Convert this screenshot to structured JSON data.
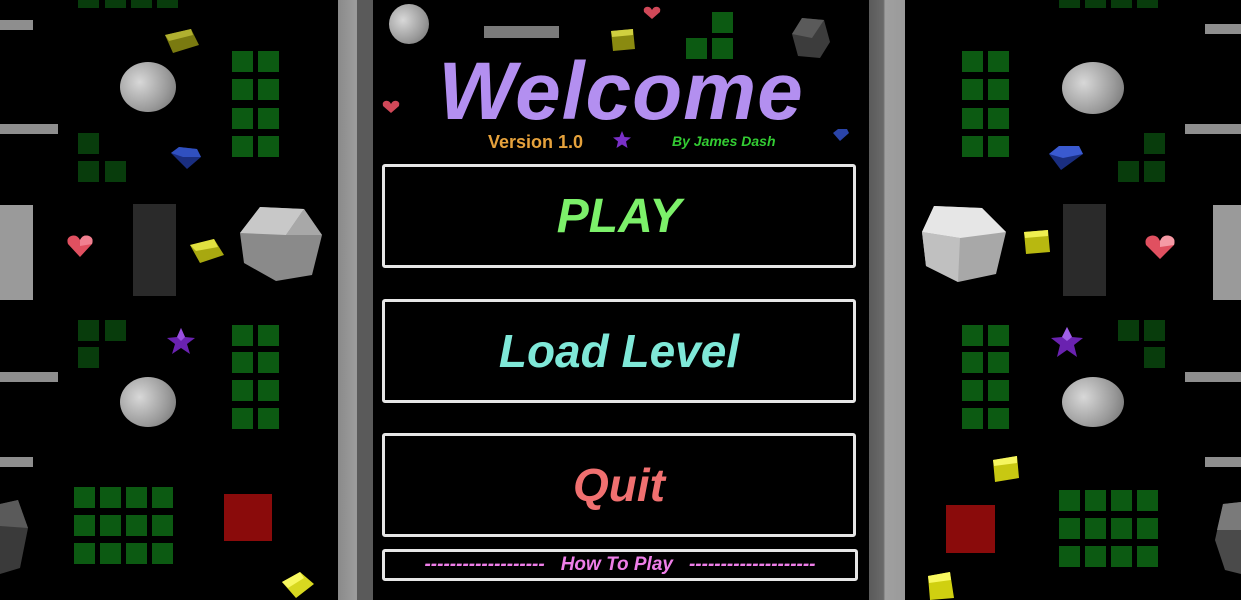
{
  "menu": {
    "title": "Welcome",
    "version": "Version 1.0",
    "author": "By James Dash",
    "play_label": "PLAY",
    "load_label": "Load Level",
    "quit_label": "Quit",
    "howto_label": "How To Play",
    "howto_dashes_left": "-------------------",
    "howto_dashes_right": "--------------------"
  },
  "colors": {
    "title": "#b38ff0",
    "version": "#e6a23c",
    "author": "#33cc33",
    "play": "#7cf06a",
    "load": "#7fe8d8",
    "quit": "#f07070",
    "howto": "#ee7ee8",
    "border": "#e6e6e6"
  },
  "decor": {
    "icons": [
      "heart-gem-icon",
      "star-gem-icon",
      "diamond-gem-icon",
      "yellow-cube-icon",
      "red-block-icon",
      "gray-cylinder-icon",
      "gray-rock-icon"
    ]
  }
}
